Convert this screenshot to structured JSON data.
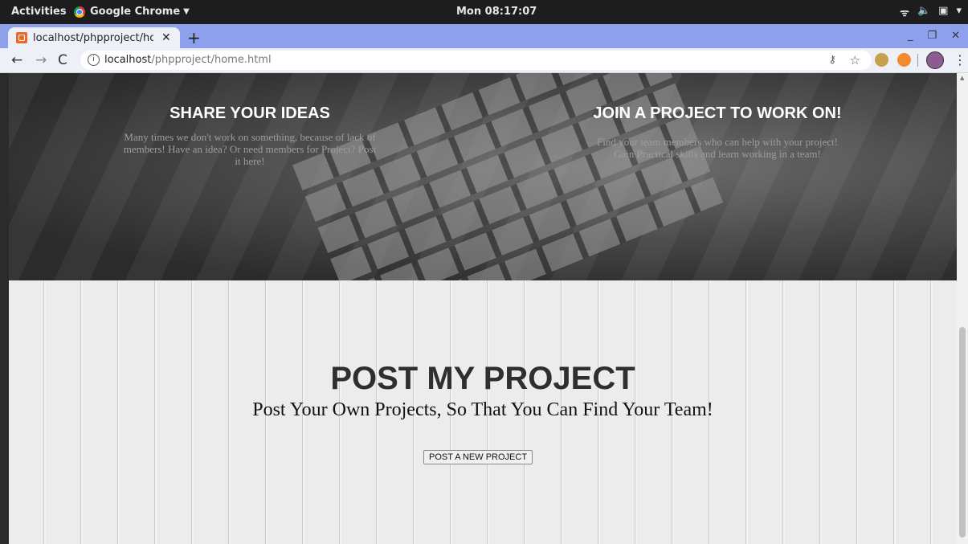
{
  "topbar": {
    "activities": "Activities",
    "app_name": "Google Chrome",
    "clock": "Mon 08:17:07"
  },
  "browser": {
    "tab_title": "localhost/phpproject/ho",
    "url_host": "localhost",
    "url_path": "/phpproject/home.html"
  },
  "hero": {
    "share_title": "SHARE YOUR IDEAS",
    "share_text": "Many times we don't work on something, because of lack of members! Have an idea? Or need members for Project? Post it here!",
    "join_title": "JOIN A PROJECT TO WORK ON!",
    "join_text": "Find your team members who can help with your project! Gain Practical skills and learn working in a team!"
  },
  "post": {
    "title": "POST MY PROJECT",
    "subtitle": "Post Your Own Projects, So That You Can Find Your Team!",
    "button": "POST A NEW PROJECT"
  }
}
